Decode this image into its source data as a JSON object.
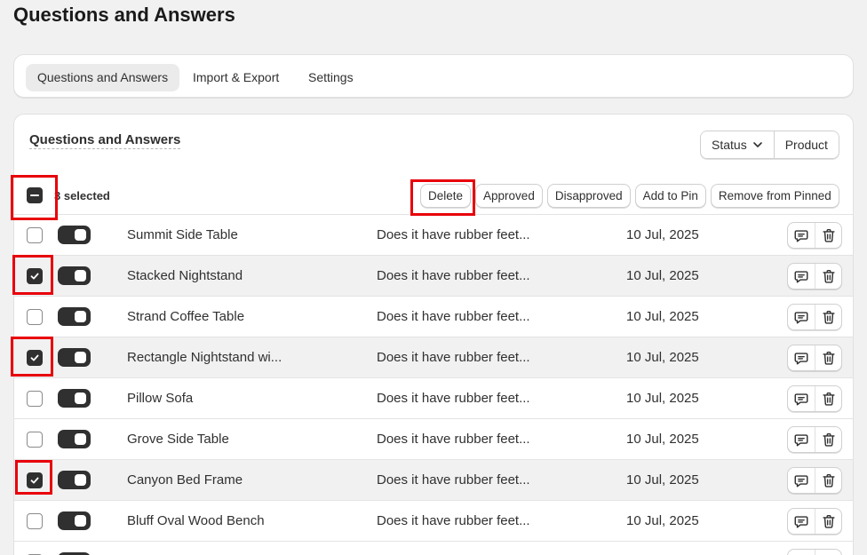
{
  "page": {
    "title": "Questions and Answers"
  },
  "tabs": [
    {
      "label": "Questions and Answers",
      "active": true
    },
    {
      "label": "Import & Export",
      "active": false
    },
    {
      "label": "Settings",
      "active": false
    }
  ],
  "card": {
    "title": "Questions and Answers",
    "filters": {
      "status_label": "Status",
      "product_label": "Product"
    }
  },
  "bulk": {
    "selected_text": "3 selected",
    "actions": {
      "delete": "Delete",
      "approved": "Approved",
      "disapproved": "Disapproved",
      "add_to_pin": "Add to Pin",
      "remove_from_pinned": "Remove from Pinned"
    }
  },
  "rows": [
    {
      "product": "Summit Side Table",
      "question": "Does it have rubber feet...",
      "date": "10 Jul, 2025",
      "checked": false,
      "published": true
    },
    {
      "product": "Stacked Nightstand",
      "question": "Does it have rubber feet...",
      "date": "10 Jul, 2025",
      "checked": true,
      "published": true
    },
    {
      "product": "Strand Coffee Table",
      "question": "Does it have rubber feet...",
      "date": "10 Jul, 2025",
      "checked": false,
      "published": true
    },
    {
      "product": "Rectangle Nightstand wi...",
      "question": "Does it have rubber feet...",
      "date": "10 Jul, 2025",
      "checked": true,
      "published": true
    },
    {
      "product": "Pillow Sofa",
      "question": "Does it have rubber feet...",
      "date": "10 Jul, 2025",
      "checked": false,
      "published": true
    },
    {
      "product": "Grove Side Table",
      "question": "Does it have rubber feet...",
      "date": "10 Jul, 2025",
      "checked": false,
      "published": true
    },
    {
      "product": "Canyon Bed Frame",
      "question": "Does it have rubber feet...",
      "date": "10 Jul, 2025",
      "checked": true,
      "published": true
    },
    {
      "product": "Bluff Oval Wood Bench",
      "question": "Does it have rubber feet...",
      "date": "10 Jul, 2025",
      "checked": false,
      "published": true
    },
    {
      "product": "",
      "question": "",
      "date": "",
      "checked": false,
      "published": true
    }
  ],
  "colors": {
    "highlight": "#e8000b",
    "dark": "#303030",
    "selected_row": "#f1f1f1"
  },
  "icons": {
    "filter_chevron": "chevron-down-icon",
    "reply": "chat-bubble-icon",
    "delete": "trash-icon"
  }
}
